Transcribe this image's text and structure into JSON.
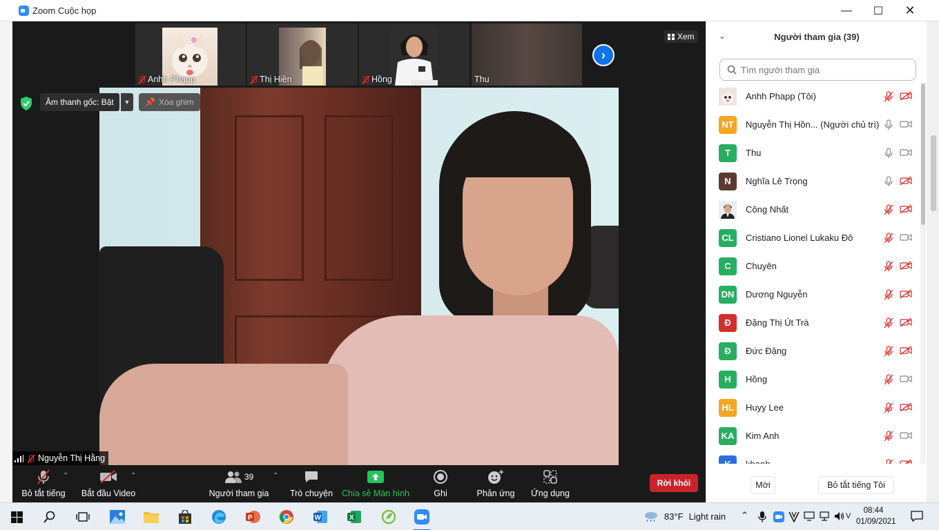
{
  "window": {
    "title": "Zoom Cuộc họp"
  },
  "thumbnails": [
    {
      "name": "Anhh Phapp",
      "muted": true
    },
    {
      "name": "Thị Hiền",
      "muted": true
    },
    {
      "name": "Hồng",
      "muted": true
    },
    {
      "name": "Thu",
      "muted": false
    }
  ],
  "view_label": "Xem",
  "original_audio_label": "Âm thanh gốc: Bật",
  "unpin_label": "Xóa ghim",
  "active_speaker": "Nguyễn Thị Hằng",
  "toolbar": {
    "mute_all": "Bỏ tắt tiếng",
    "start_video": "Bắt đầu Video",
    "participants": "Người tham gia",
    "participants_count": "39",
    "chat": "Trò chuyện",
    "share": "Chia sẻ Màn hình",
    "record": "Ghi",
    "reactions": "Phản ứng",
    "apps": "Ứng dụng",
    "leave": "Rời khỏi"
  },
  "panel": {
    "title": "Người tham gia (39)",
    "search_placeholder": "Tìm người tham gia",
    "invite": "Mời",
    "unmute_me": "Bỏ tắt tiếng Tôi",
    "participants": [
      {
        "initials": "",
        "name": "Anhh Phapp (Tôi)",
        "avatar": "cat-photo",
        "color": "#e8d8c8",
        "mic": "off",
        "video": "off"
      },
      {
        "initials": "NT",
        "name": "Nguyễn Thị Hồn...  (Người chủ trì)",
        "avatar": "initials",
        "color": "#f5a623",
        "mic": "on",
        "video": "on"
      },
      {
        "initials": "T",
        "name": "Thu",
        "avatar": "initials",
        "color": "#27ae60",
        "mic": "on",
        "video": "on"
      },
      {
        "initials": "N",
        "name": "Nghĩa Lê Trọng",
        "avatar": "initials",
        "color": "#5d3a30",
        "mic": "on",
        "video": "off"
      },
      {
        "initials": "",
        "name": "Công Nhất",
        "avatar": "person-photo",
        "color": "#dfe6ea",
        "mic": "off",
        "video": "off"
      },
      {
        "initials": "CL",
        "name": "Cristiano Lionel Lukaku Đô",
        "avatar": "initials",
        "color": "#27ae60",
        "mic": "off",
        "video": "on"
      },
      {
        "initials": "C",
        "name": "Chuyên",
        "avatar": "initials",
        "color": "#27ae60",
        "mic": "off",
        "video": "off"
      },
      {
        "initials": "DN",
        "name": "Dương Nguyễn",
        "avatar": "initials",
        "color": "#27ae60",
        "mic": "off",
        "video": "off"
      },
      {
        "initials": "Đ",
        "name": "Đặng Thị Út Trà",
        "avatar": "initials",
        "color": "#d0312d",
        "mic": "off",
        "video": "off"
      },
      {
        "initials": "Đ",
        "name": "Đức Đặng",
        "avatar": "initials",
        "color": "#27ae60",
        "mic": "off",
        "video": "off"
      },
      {
        "initials": "H",
        "name": "Hồng",
        "avatar": "initials",
        "color": "#27ae60",
        "mic": "off",
        "video": "on"
      },
      {
        "initials": "HL",
        "name": "Huyy Lee",
        "avatar": "initials",
        "color": "#f5a623",
        "mic": "off",
        "video": "off"
      },
      {
        "initials": "KA",
        "name": "Kim Anh",
        "avatar": "initials",
        "color": "#27ae60",
        "mic": "off",
        "video": "on"
      },
      {
        "initials": "K",
        "name": "khanh",
        "avatar": "initials",
        "color": "#2d6cdf",
        "mic": "off",
        "video": "off"
      }
    ]
  },
  "taskbar": {
    "weather_temp": "83°F",
    "weather_text": "Light rain",
    "time": "08:44",
    "date": "01/09/2021"
  },
  "colors": {
    "zoom_blue": "#0e72ed",
    "leave_red": "#c8232c",
    "share_green": "#22c55e",
    "muted_red": "#e02828"
  }
}
